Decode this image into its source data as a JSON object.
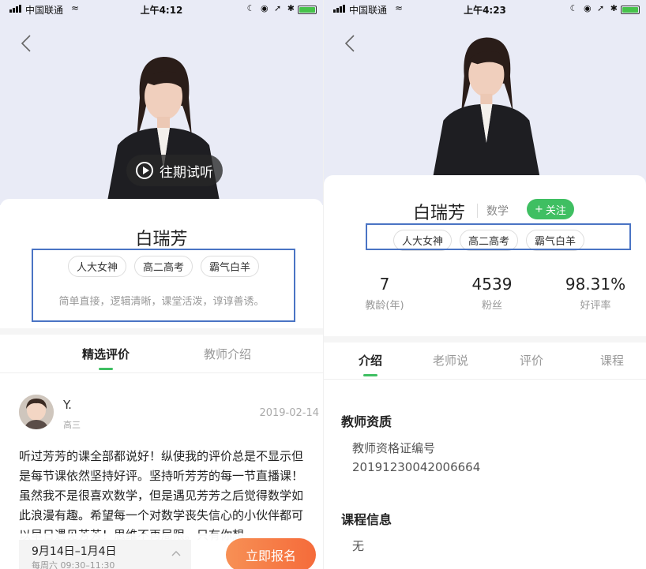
{
  "left": {
    "status": {
      "carrier": "中国联通",
      "time": "上午4:12"
    },
    "teacher_name": "白瑞芳",
    "trial_label": "往期试听",
    "tags": [
      "人大女神",
      "高二高考",
      "霸气白羊"
    ],
    "description": "简单直接，逻辑清晰，课堂活泼，谆谆善诱。",
    "tabs": [
      "精选评价",
      "教师介绍"
    ],
    "review": {
      "name": "Y.",
      "grade": "高三",
      "date": "2019-02-14",
      "text": "听过芳芳的课全部都说好！纵使我的评价总是不显示但是每节课依然坚持好评。坚持听芳芳的每一节直播课！虽然我不是很喜欢数学，但是遇见芳芳之后觉得数学如此浪漫有趣。希望每一个对数学丧失信心的小伙伴都可以早日遇见芳芳！思维不再局限。只有你想"
    },
    "bottom": {
      "course_dates": "9月14日–1月4日",
      "course_schedule": "每周六 09:30–11:30",
      "signup_label": "立即报名"
    }
  },
  "right": {
    "status": {
      "carrier": "中国联通",
      "time": "上午4:23"
    },
    "teacher_name": "白瑞芳",
    "subject": "数学",
    "follow_label": "关注",
    "tags": [
      "人大女神",
      "高二高考",
      "霸气白羊"
    ],
    "stats": [
      {
        "value": "7",
        "label": "教龄(年)"
      },
      {
        "value": "4539",
        "label": "粉丝"
      },
      {
        "value": "98.31%",
        "label": "好评率"
      }
    ],
    "tabs": [
      "介绍",
      "老师说",
      "评价",
      "课程"
    ],
    "qualification": {
      "title": "教师资质",
      "cert_label": "教师资格证编号",
      "cert_number": "20191230042006664"
    },
    "course_info": {
      "title": "课程信息",
      "value": "无"
    }
  },
  "colors": {
    "accent_green": "#3fbf62",
    "signup_orange": "#f56b3a",
    "highlight_blue": "#4a74c4",
    "hero_bg": "#e9ebf6"
  },
  "icons": [
    "back-arrow-icon",
    "play-circle-icon",
    "chevron-up-icon",
    "plus-icon",
    "wifi-icon",
    "battery-icon"
  ]
}
